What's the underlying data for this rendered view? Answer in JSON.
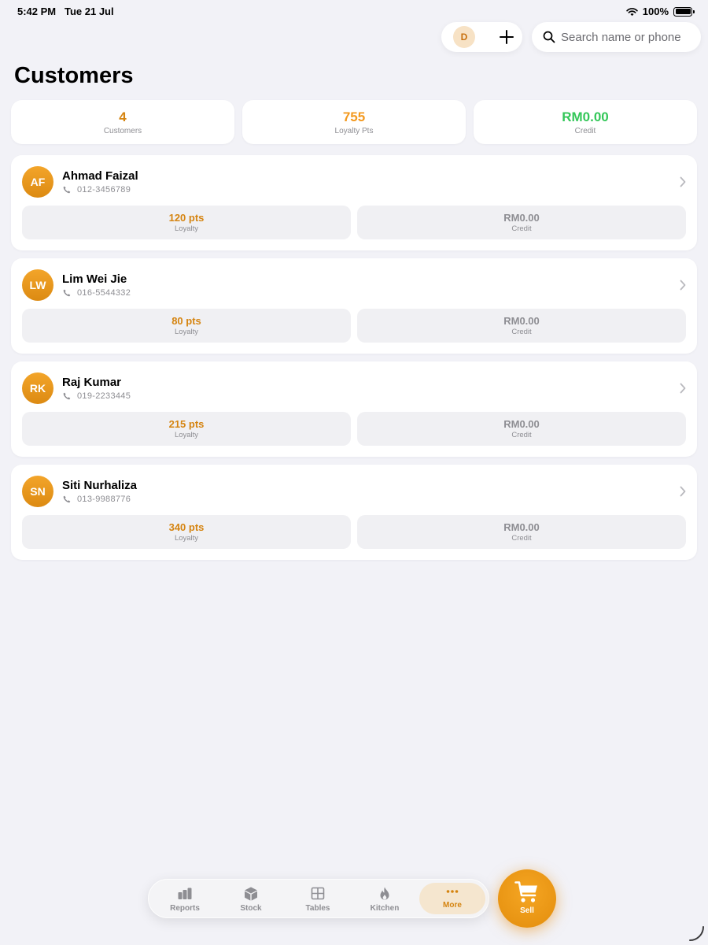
{
  "status_bar": {
    "time": "5:42 PM",
    "date": "Tue 21 Jul",
    "battery": "100%",
    "battery_level": 1.0
  },
  "header": {
    "user_initial": "D",
    "add_icon": "plus-icon",
    "search_placeholder": "Search name or phone",
    "search_value": ""
  },
  "page": {
    "title": "Customers"
  },
  "summary": [
    {
      "value": "4",
      "label": "Customers",
      "color": "#d58410"
    },
    {
      "value": "755",
      "label": "Loyalty Pts",
      "color": "#f3991e"
    },
    {
      "value": "RM0.00",
      "label": "Credit",
      "color": "#34c759"
    }
  ],
  "customers": [
    {
      "initials": "AF",
      "name": "Ahmad Faizal",
      "phone": "012-3456789",
      "loyalty": "120 pts",
      "loyalty_label": "Loyalty",
      "credit": "RM0.00",
      "credit_label": "Credit"
    },
    {
      "initials": "LW",
      "name": "Lim Wei Jie",
      "phone": "016-5544332",
      "loyalty": "80 pts",
      "loyalty_label": "Loyalty",
      "credit": "RM0.00",
      "credit_label": "Credit"
    },
    {
      "initials": "RK",
      "name": "Raj Kumar",
      "phone": "019-2233445",
      "loyalty": "215 pts",
      "loyalty_label": "Loyalty",
      "credit": "RM0.00",
      "credit_label": "Credit"
    },
    {
      "initials": "SN",
      "name": "Siti Nurhaliza",
      "phone": "013-9988776",
      "loyalty": "340 pts",
      "loyalty_label": "Loyalty",
      "credit": "RM0.00",
      "credit_label": "Credit"
    }
  ],
  "colors": {
    "accent": "#e38d0c",
    "loyalty_text": "#d58410",
    "credit_text": "#8e8e93",
    "background": "#f2f2f7"
  },
  "tab_bar": {
    "tabs": [
      {
        "label": "Reports",
        "icon": "bar-chart-icon"
      },
      {
        "label": "Stock",
        "icon": "box-icon"
      },
      {
        "label": "Tables",
        "icon": "grid-icon"
      },
      {
        "label": "Kitchen",
        "icon": "flame-icon"
      },
      {
        "label": "More",
        "icon": "more-dots-icon",
        "active": true
      }
    ],
    "sell_label": "Sell",
    "sell_icon": "cart-icon"
  }
}
